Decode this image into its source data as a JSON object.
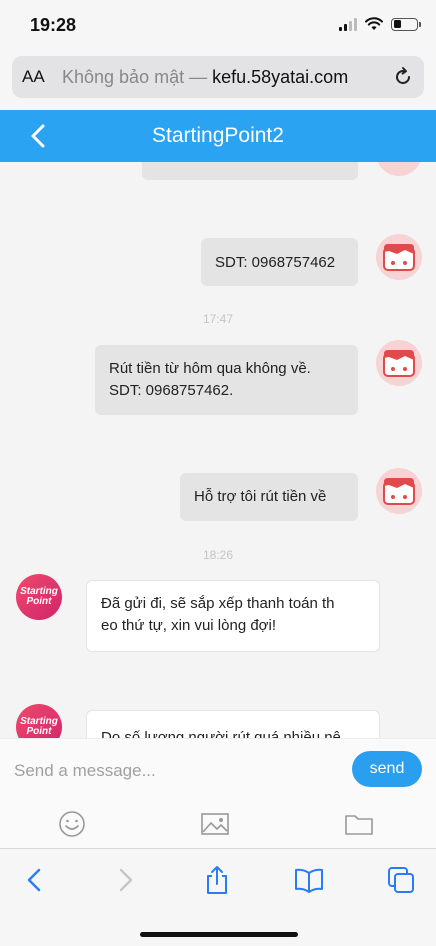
{
  "status": {
    "time": "19:28"
  },
  "browser": {
    "text_size_label": "AA",
    "security_label": "Không bảo mật —",
    "domain": "kefu.58yatai.com"
  },
  "header": {
    "title": "StartingPoint2"
  },
  "messages": [
    {
      "side": "me",
      "text": "SDT: 0968757462"
    },
    {
      "timestamp": "17:47"
    },
    {
      "side": "me",
      "text": "Rút tiền từ hôm qua không về.\nSDT: 0968757462."
    },
    {
      "side": "me",
      "text": "Hỗ trợ tôi rút tiền về"
    },
    {
      "timestamp": "18:26"
    },
    {
      "side": "them",
      "text": "Đã gửi đi, sẽ sắp xếp thanh toán th\neo thứ tự, xin vui lòng đợi!"
    },
    {
      "side": "them",
      "text": "Do số lượng người rút quá nhiều nê"
    }
  ],
  "agent_avatar_text": "Starting Point",
  "composer": {
    "placeholder": "Send a message...",
    "send_label": "send"
  },
  "colors": {
    "brand_blue": "#2aa3f2",
    "send_blue": "#2a9ff0"
  },
  "icons": [
    "emoji-icon",
    "image-icon",
    "folder-icon",
    "back-icon",
    "forward-icon",
    "share-icon",
    "bookmarks-icon",
    "tabs-icon"
  ]
}
